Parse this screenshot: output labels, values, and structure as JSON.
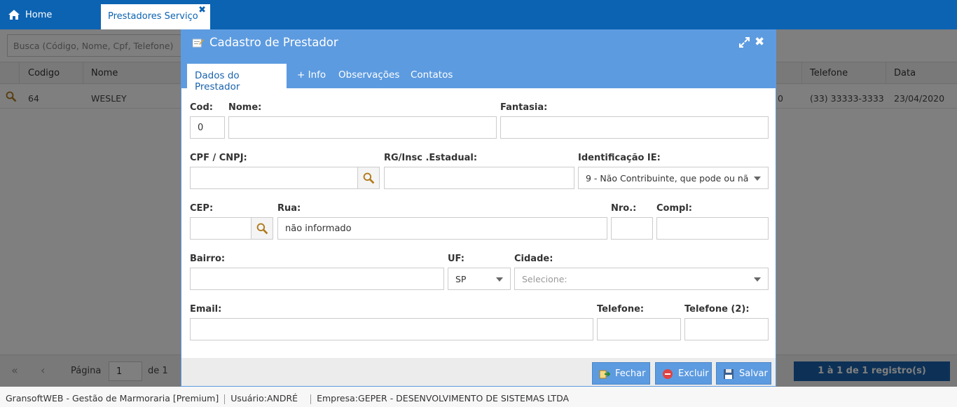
{
  "top_tabs": {
    "home": "Home",
    "active": "Prestadores Serviço",
    "close": "✖"
  },
  "background": {
    "search_placeholder": "Busca (Código, Nome, Cpf, Telefone)",
    "columns": {
      "codigo": "Codigo",
      "nome": "Nome",
      "telefone": "Telefone",
      "data": "Data"
    },
    "row": {
      "codigo": "64",
      "nome": "WESLEY",
      "hidden_partial": "0",
      "telefone": "(33) 33333-3333",
      "data": "23/04/2020"
    },
    "pager": {
      "pagina_label": "Página",
      "pagina_value": "1",
      "de_label": "de 1",
      "registros": "1 à 1 de 1 registro(s)"
    }
  },
  "status_bar": {
    "app": "GransoftWEB - Gestão de Marmoraria [Premium]",
    "usuario_label": "Usuário:",
    "usuario": "ANDRÉ",
    "empresa_label": "Empresa:",
    "empresa": "GEPER - DESENVOLVIMENTO DE SISTEMAS LTDA"
  },
  "modal": {
    "title": "Cadastro de Prestador",
    "tabs": [
      "Dados do Prestador",
      "+ Info",
      "Observações",
      "Contatos"
    ],
    "fields": {
      "cod": {
        "label": "Cod:",
        "value": "0"
      },
      "nome": {
        "label": "Nome:",
        "value": ""
      },
      "fantasia": {
        "label": "Fantasia:",
        "value": ""
      },
      "cpf_cnpj": {
        "label": "CPF / CNPJ:",
        "value": ""
      },
      "rg_ie": {
        "label": "RG/Insc .Estadual:",
        "value": ""
      },
      "identificacao_ie": {
        "label": "Identificação IE:",
        "value": "9 - Não Contribuinte, que pode ou nã"
      },
      "cep": {
        "label": "CEP:",
        "value": ""
      },
      "rua": {
        "label": "Rua:",
        "value": "não informado"
      },
      "nro": {
        "label": "Nro.:",
        "value": ""
      },
      "compl": {
        "label": "Compl:",
        "value": ""
      },
      "bairro": {
        "label": "Bairro:",
        "value": ""
      },
      "uf": {
        "label": "UF:",
        "value": "SP"
      },
      "cidade": {
        "label": "Cidade:",
        "placeholder": "Selecione:"
      },
      "email": {
        "label": "Email:",
        "value": ""
      },
      "telefone": {
        "label": "Telefone:",
        "value": ""
      },
      "telefone2": {
        "label": "Telefone (2):",
        "value": ""
      }
    },
    "buttons": {
      "fechar": "Fechar",
      "excluir": "Excluir",
      "salvar": "Salvar"
    }
  },
  "colors": {
    "topbar": "#0b63b2",
    "modal_header": "#5d9be0",
    "button": "#5d9be0"
  }
}
